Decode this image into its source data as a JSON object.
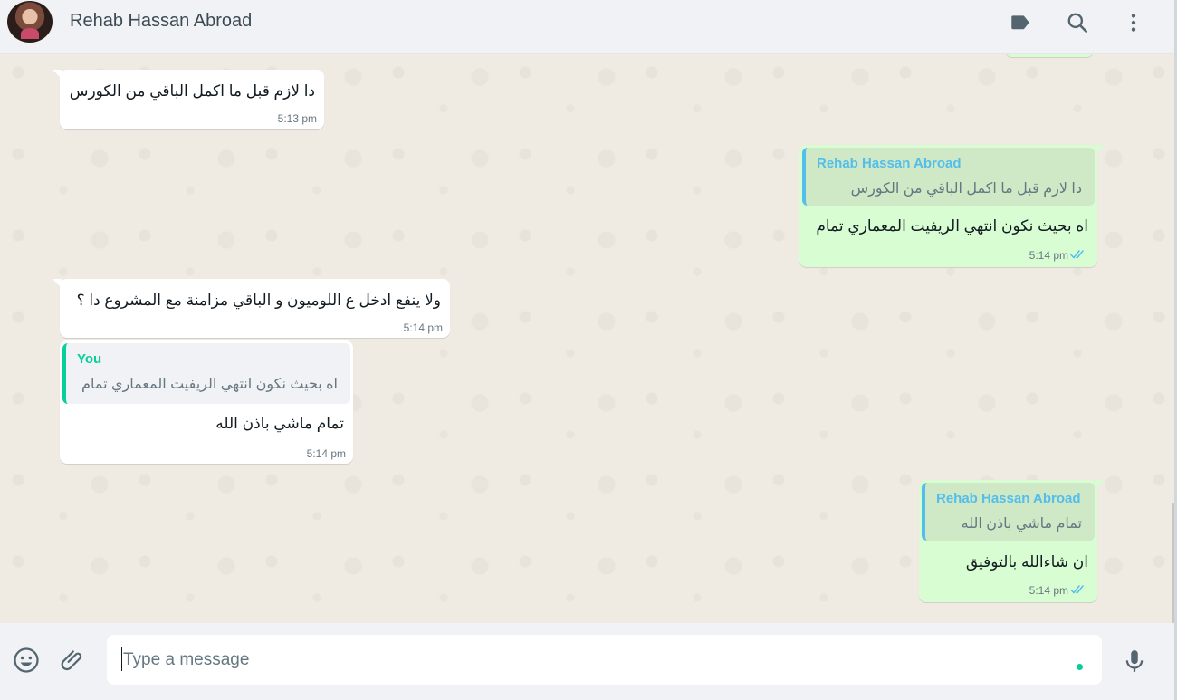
{
  "header": {
    "contact_name": "Rehab Hassan Abroad",
    "icons": [
      "label-icon",
      "search-icon",
      "menu-icon"
    ]
  },
  "messages": [
    {
      "direction": "in",
      "text": "دا لازم قبل ما اكمل الباقي من الكورس",
      "time": "5:13 pm"
    },
    {
      "direction": "out",
      "quoted_name": "Rehab Hassan Abroad",
      "quoted_text": "دا لازم قبل ما اكمل الباقي من الكورس",
      "text": "اه بحيث نكون انتهي الريفيت المعماري تمام",
      "time": "5:14 pm",
      "status": "delivered"
    },
    {
      "direction": "in",
      "text": "ولا ينفع ادخل ع اللوميون و الباقي مزامنة مع المشروع دا ؟",
      "time": "5:14 pm"
    },
    {
      "direction": "in",
      "quoted_name": "You",
      "quoted_text": "اه بحيث نكون انتهي الريفيت المعماري تمام",
      "text": "تمام ماشي باذن الله",
      "time": "5:14 pm"
    },
    {
      "direction": "out",
      "quoted_name": "Rehab Hassan Abroad",
      "quoted_text": "تمام ماشي باذن الله",
      "text": "ان شاءالله بالتوفيق",
      "time": "5:14 pm",
      "status": "delivered"
    }
  ],
  "composer": {
    "placeholder": "Type a message",
    "icons": [
      "emoji-icon",
      "attach-icon",
      "mic-icon"
    ]
  },
  "colors": {
    "incoming_bubble": "#ffffff",
    "outgoing_bubble": "#d9fdd3",
    "tick_blue": "#53bdeb",
    "quote_you": "#06cf9c"
  }
}
